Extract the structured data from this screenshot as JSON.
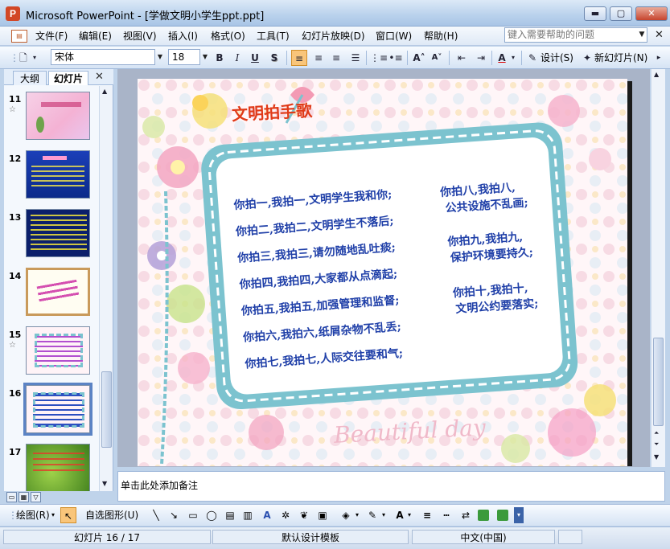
{
  "window": {
    "title": "Microsoft PowerPoint - [学做文明小学生ppt.ppt]",
    "app_icon": "P",
    "buttons": {
      "minimize": "▬",
      "maximize": "▢",
      "close": "✕"
    }
  },
  "menubar": {
    "items": [
      "文件(F)",
      "编辑(E)",
      "视图(V)",
      "插入(I)",
      "格式(O)",
      "工具(T)",
      "幻灯片放映(D)",
      "窗口(W)",
      "帮助(H)"
    ],
    "help_placeholder": "键入需要帮助的问题",
    "close": "✕"
  },
  "toolbar": {
    "font": "宋体",
    "size": "18",
    "bold": "B",
    "italic": "I",
    "underline": "U",
    "shadow": "S",
    "font_color": "A",
    "design_label": "设计(S)",
    "new_slide_label": "新幻灯片(N)"
  },
  "left_panel": {
    "tabs": [
      "大纲",
      "幻灯片"
    ],
    "close": "✕",
    "slides": [
      {
        "num": "11",
        "star": "☆"
      },
      {
        "num": "12",
        "star": ""
      },
      {
        "num": "13",
        "star": ""
      },
      {
        "num": "14",
        "star": ""
      },
      {
        "num": "15",
        "star": "☆"
      },
      {
        "num": "16",
        "star": ""
      },
      {
        "num": "17",
        "star": ""
      }
    ]
  },
  "slide": {
    "title": "文明拍手歌",
    "left_lines": [
      "你拍一,我拍一,文明学生我和你;",
      "你拍二,我拍二,文明学生不落后;",
      "你拍三,我拍三,请勿随地乱吐痰;",
      "你拍四,我拍四,大家都从点滴起;",
      "你拍五,我拍五,加强管理和监督;",
      "你拍六,我拍六,纸屑杂物不乱丢;",
      "你拍七,我拍七,人际交往要和气;"
    ],
    "right_lines": [
      "你拍八,我拍八,",
      "公共设施不乱画;",
      "你拍九,我拍九,",
      "保护环境要持久;",
      "你拍十,我拍十,",
      "文明公约要落实;"
    ],
    "decor_text": "Beautiful day"
  },
  "notes": {
    "placeholder": "单击此处添加备注"
  },
  "drawbar": {
    "draw_label": "绘图(R)",
    "autoshape_label": "自选图形(U)"
  },
  "statusbar": {
    "slide_info": "幻灯片 16 / 17",
    "template": "默认设计模板",
    "language": "中文(中国)"
  },
  "colors": {
    "title_red": "#e03a18",
    "poem_blue": "#1f3fa8",
    "frame_teal": "#7cc3cf",
    "selection": "#5b83c4"
  }
}
